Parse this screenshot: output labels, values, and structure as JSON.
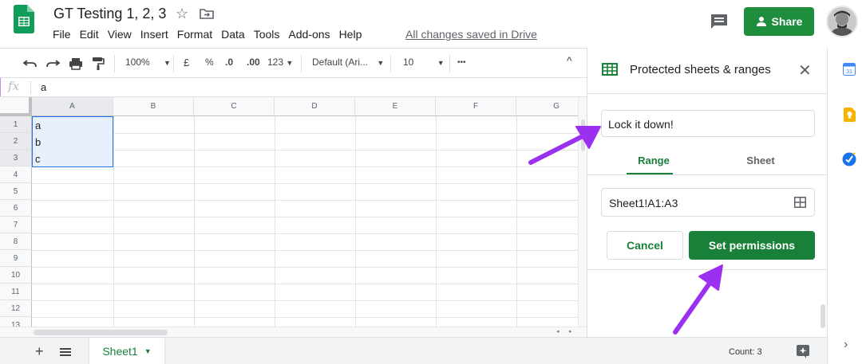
{
  "header": {
    "title": "GT Testing 1, 2, 3",
    "menu": [
      "File",
      "Edit",
      "View",
      "Insert",
      "Format",
      "Data",
      "Tools",
      "Add-ons",
      "Help"
    ],
    "saved_status": "All changes saved in Drive",
    "share_label": "Share"
  },
  "toolbar": {
    "zoom": "100%",
    "currency": "£",
    "percent": "%",
    "dec_less": ".0",
    "dec_more": ".00",
    "format_more": "123",
    "font": "Default (Ari...",
    "font_size": "10",
    "more": "•••"
  },
  "formula_bar": {
    "fx_label": "fx",
    "value": "a"
  },
  "grid": {
    "columns": [
      "A",
      "B",
      "C",
      "D",
      "E",
      "F",
      "G"
    ],
    "rows": [
      "1",
      "2",
      "3",
      "4",
      "5",
      "6",
      "7",
      "8",
      "9",
      "10",
      "11",
      "12",
      "13"
    ],
    "cells": [
      "a",
      "b",
      "c"
    ]
  },
  "panel": {
    "title": "Protected sheets & ranges",
    "description_value": "Lock it down!",
    "tabs": [
      "Range",
      "Sheet"
    ],
    "active_tab": "Range",
    "range_value": "Sheet1!A1:A3",
    "cancel_label": "Cancel",
    "set_permissions_label": "Set permissions"
  },
  "bottom": {
    "sheet_name": "Sheet1",
    "count_label": "Count: 3"
  },
  "colors": {
    "green": "#188038",
    "selection_border": "#1a73e8",
    "selection_fill": "#e8f0fe",
    "annotation_arrow": "#9b30f0"
  }
}
